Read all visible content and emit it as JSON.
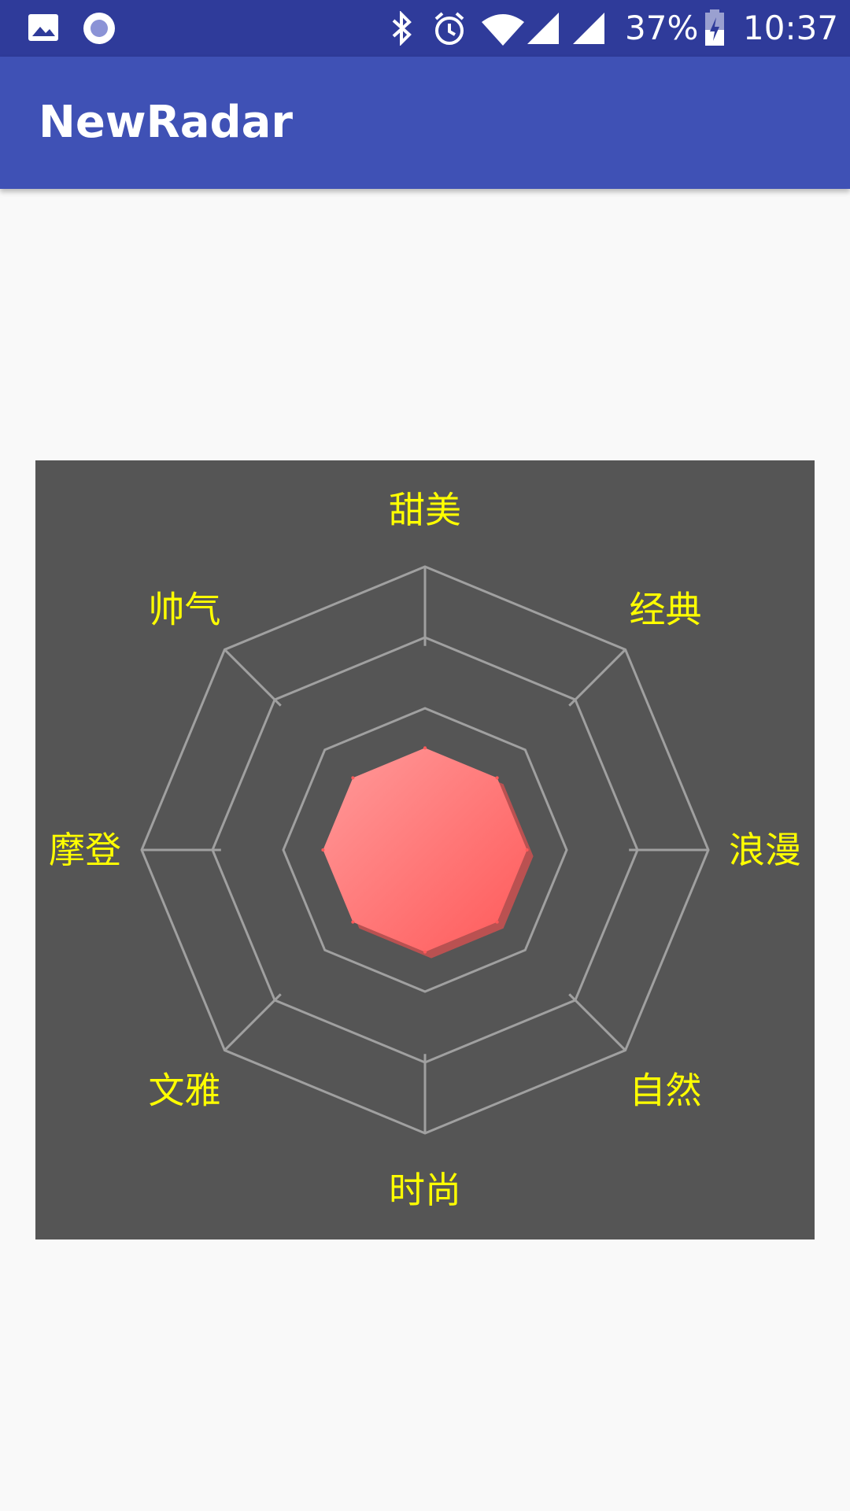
{
  "status_bar": {
    "icons_left": [
      "gallery-icon",
      "record-icon"
    ],
    "icons_right": [
      "bluetooth-icon",
      "alarm-icon",
      "wifi-icon",
      "cell-signal-icon",
      "cell-signal-icon",
      "battery-charging-icon"
    ],
    "battery": "37%",
    "time": "10:37"
  },
  "app_bar": {
    "title": "NewRadar",
    "color": "#3f51b5"
  },
  "chart_data": {
    "type": "radar",
    "categories": [
      "甜美",
      "经典",
      "浪漫",
      "自然",
      "时尚",
      "文雅",
      "摩登",
      "帅气"
    ],
    "levels": 4,
    "max": 1,
    "series": [
      {
        "values": [
          0.36,
          0.36,
          0.36,
          0.36,
          0.36,
          0.36,
          0.36,
          0.36
        ]
      }
    ],
    "colors": {
      "background": "#555555",
      "grid": "#a0a0a0",
      "label": "#ffff00",
      "fill_start": "#ff9a9a",
      "fill_end": "#ff5a5a"
    }
  }
}
